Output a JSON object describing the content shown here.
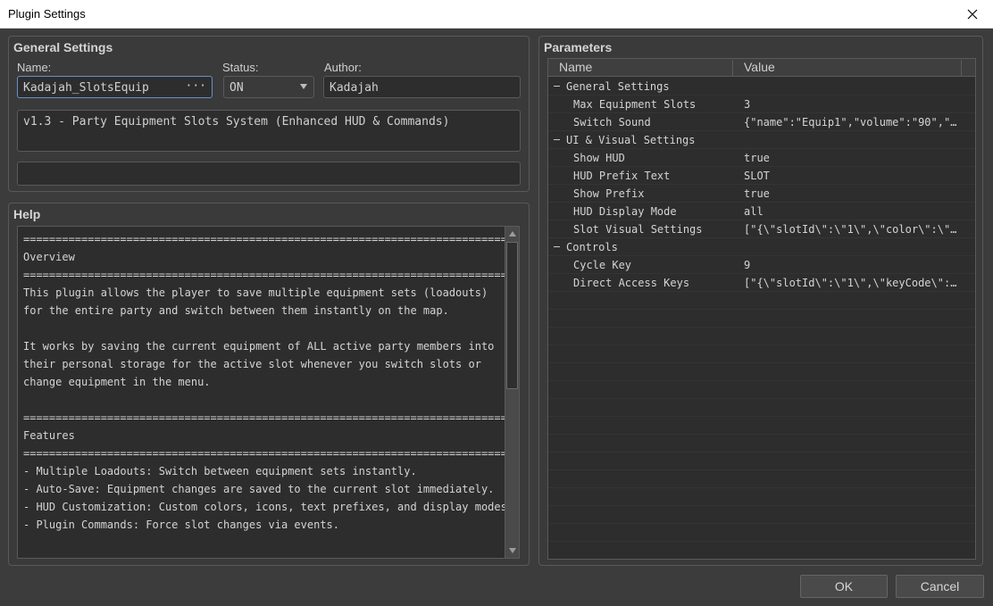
{
  "window": {
    "title": "Plugin Settings"
  },
  "general": {
    "title": "General Settings",
    "name_label": "Name:",
    "name_value": "Kadajah_SlotsEquip",
    "name_button": "···",
    "status_label": "Status:",
    "status_value": "ON",
    "author_label": "Author:",
    "author_value": "Kadajah",
    "description": "v1.3 - Party Equipment Slots System (Enhanced HUD & Commands)",
    "note": ""
  },
  "help": {
    "title": "Help",
    "lines": [
      "=============================================================================",
      "Overview",
      "=============================================================================",
      "This plugin allows the player to save multiple equipment sets (loadouts)",
      "for the entire party and switch between them instantly on the map.",
      "",
      "It works by saving the current equipment of ALL active party members into",
      "their personal storage for the active slot whenever you switch slots or",
      "change equipment in the menu.",
      "",
      "=============================================================================",
      "Features",
      "=============================================================================",
      "- Multiple Loadouts: Switch between equipment sets instantly.",
      "- Auto-Save: Equipment changes are saved to the current slot immediately.",
      "- HUD Customization: Custom colors, icons, text prefixes, and display modes.",
      "- Plugin Commands: Force slot changes via events."
    ]
  },
  "params": {
    "title": "Parameters",
    "col_name": "Name",
    "col_value": "Value",
    "rows": [
      {
        "name": "General Settings",
        "value": ""
      },
      {
        "name": "Max Equipment Slots",
        "value": "3"
      },
      {
        "name": "Switch Sound",
        "value": "{\"name\":\"Equip1\",\"volume\":\"90\",\"..."
      },
      {
        "name": "UI & Visual Settings",
        "value": ""
      },
      {
        "name": "Show HUD",
        "value": "true"
      },
      {
        "name": "HUD Prefix Text",
        "value": "SLOT"
      },
      {
        "name": "Show Prefix",
        "value": "true"
      },
      {
        "name": "HUD Display Mode",
        "value": "all"
      },
      {
        "name": "Slot Visual Settings",
        "value": "[\"{\\\"slotId\\\":\\\"1\\\",\\\"color\\\":\\\"..."
      },
      {
        "name": "Controls",
        "value": ""
      },
      {
        "name": "Cycle Key",
        "value": "9"
      },
      {
        "name": "Direct Access Keys",
        "value": "[\"{\\\"slotId\\\":\\\"1\\\",\\\"keyCode\\\":..."
      }
    ]
  },
  "buttons": {
    "ok": "OK",
    "cancel": "Cancel"
  }
}
